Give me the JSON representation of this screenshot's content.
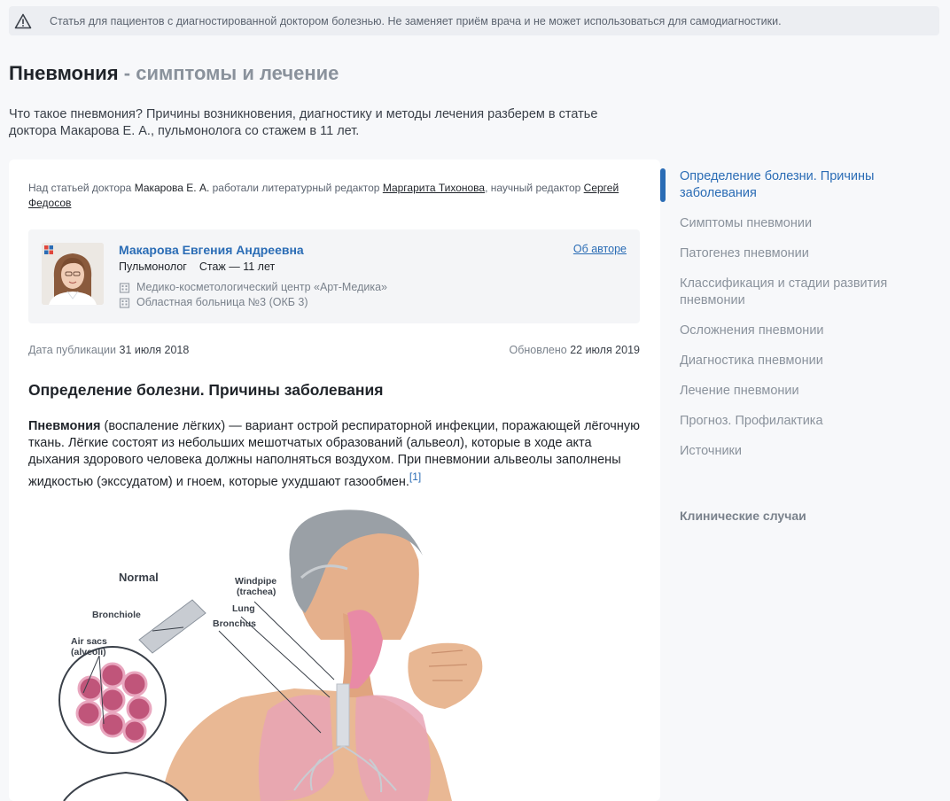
{
  "notice": {
    "icon": "warning-icon",
    "text": "Статья для пациентов с диагностированной доктором болезнью. Не заменяет приём врача и не может использоваться для самодиагностики."
  },
  "header": {
    "title": "Пневмония",
    "subtitle": " - симптомы и лечение",
    "lead": "Что такое пневмония? Причины возникновения, диагностику и методы лечения разберем в статье доктора Макарова Е. А., пульмонолога со стажем в 11 лет."
  },
  "editors": {
    "prefix": "Над статьей доктора ",
    "doctor": "Макарова Е. А.",
    "mid1": " работали литературный редактор ",
    "lit_editor": "Маргарита Тихонова",
    "mid2": ", научный редактор ",
    "sci_editor": "Сергей Федосов"
  },
  "author": {
    "name": "Макарова Евгения Андреевна",
    "specialty": "Пульмонолог",
    "experience": "Стаж — 11 лет",
    "about_link": "Об авторе",
    "clinics": [
      "Медико-косметологический центр «Арт-Медика»",
      "Областная больница №3 (ОКБ 3)"
    ]
  },
  "dates": {
    "published_label": "Дата публикации",
    "published": "31 июля 2018",
    "updated_label": "Обновлено",
    "updated": "22 июля 2019"
  },
  "section": {
    "title": "Определение болезни. Причины заболевания",
    "term": "Пневмония",
    "text": " (воспаление лёгких) — вариант острой респираторной инфекции, поражающей лёгочную ткань. Лёгкие состоят из небольших мешотчатых образований (альвеол), которые в ходе акта дыхания здорового человека должны наполняться воздухом. При пневмонии альвеолы заполнены жидкостью (экссудатом) и гноем, которые ухудшают газообмен.",
    "ref": "[1]"
  },
  "illustration": {
    "labels": {
      "normal": "Normal",
      "bronchiole": "Bronchiole",
      "air_sacs": "Air sacs",
      "alveoli": "(alveoli)",
      "windpipe": "Windpipe",
      "trachea": "(trachea)",
      "lung": "Lung",
      "bronchus": "Bronchus"
    }
  },
  "toc": {
    "items": [
      "Определение болезни. Причины заболевания",
      "Симптомы пневмонии",
      "Патогенез пневмонии",
      "Классификация и стадии развития пневмонии",
      "Осложнения пневмонии",
      "Диагностика пневмонии",
      "Лечение пневмонии",
      "Прогноз. Профилактика",
      "Источники"
    ],
    "clinical_cases": "Клинические случаи"
  },
  "colors": {
    "accent": "#2a6cb5",
    "muted": "#8a929c",
    "background": "#f7f8fa"
  }
}
